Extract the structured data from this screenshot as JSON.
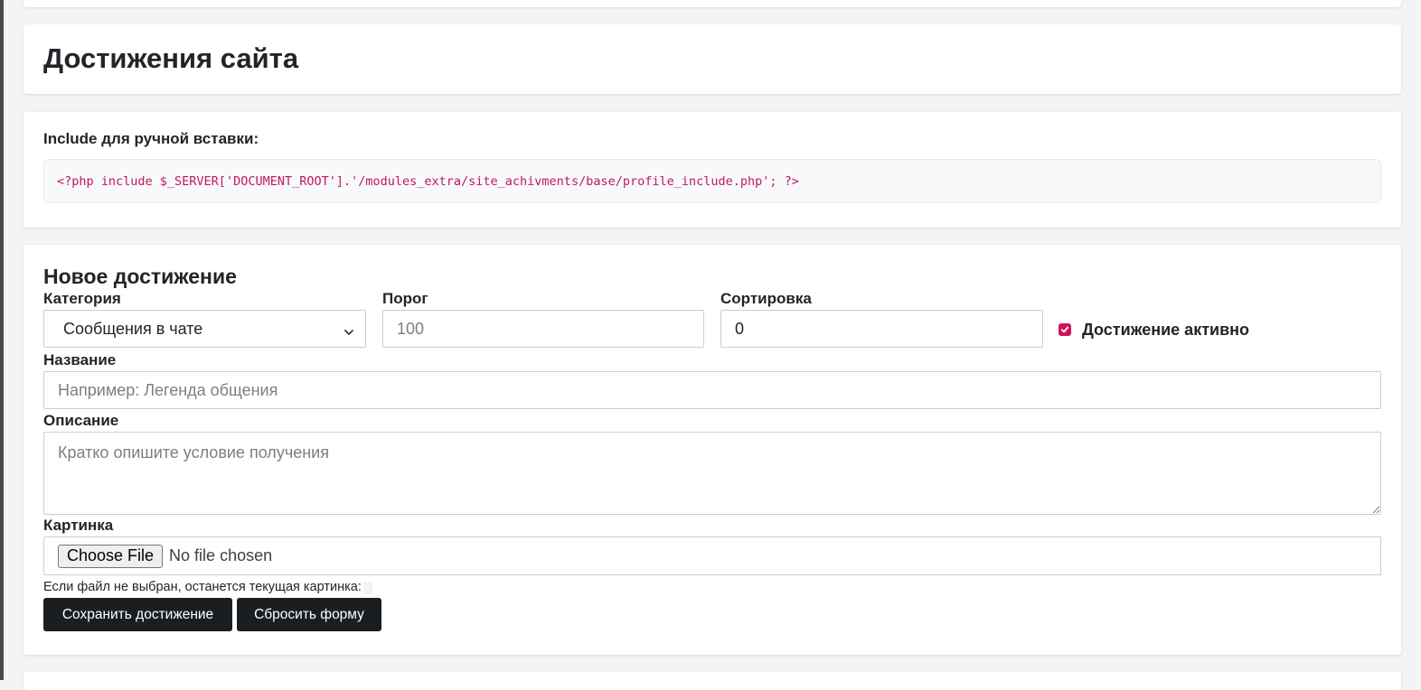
{
  "header": {
    "title": "Достижения сайта"
  },
  "include": {
    "label": "Include для ручной вставки:",
    "code": "<?php include $_SERVER['DOCUMENT_ROOT'].'/modules_extra/site_achivments/base/profile_include.php'; ?>"
  },
  "form": {
    "title": "Новое достижение",
    "category": {
      "label": "Категория",
      "value": "Сообщения в чате"
    },
    "threshold": {
      "label": "Порог",
      "placeholder": "100"
    },
    "sort": {
      "label": "Сортировка",
      "value": "0"
    },
    "active": {
      "label": "Достижение активно",
      "checked": true
    },
    "name": {
      "label": "Название",
      "placeholder": "Например: Легенда общения"
    },
    "description": {
      "label": "Описание",
      "placeholder": "Кратко опишите условие получения"
    },
    "image": {
      "label": "Картинка",
      "button_label": "Choose File",
      "status": "No file chosen",
      "hint": "Если файл не выбран, останется текущая картинка:"
    },
    "buttons": {
      "save": "Сохранить достижение",
      "reset": "Сбросить форму"
    }
  },
  "colors": {
    "code_text": "#c2185b",
    "checkbox": "#d1135c",
    "button_bg": "#1b1e21"
  }
}
